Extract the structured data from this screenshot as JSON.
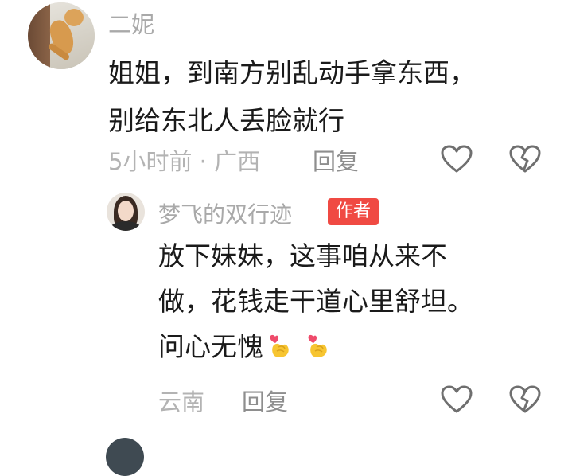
{
  "main_comment": {
    "username": "二妮",
    "text_lines": [
      "姐姐，到南方别乱动手拿东西，",
      "别给东北人丢脸就行"
    ],
    "meta": "5小时前 · 广西",
    "reply_label": "回复",
    "icons": {
      "avatar": "cat-photo-avatar",
      "like": "heart-outline-icon",
      "dislike": "broken-heart-icon"
    }
  },
  "reply_comment": {
    "username": "梦飞的双行迹",
    "badge": "作者",
    "text_lines": [
      "放下妹妹，这事咱从来不",
      "做，花钱走干道心里舒坦。",
      "问心无愧"
    ],
    "emoji": [
      "finger-heart-emoji",
      "finger-heart-emoji"
    ],
    "meta": "云南",
    "reply_label": "回复",
    "icons": {
      "avatar": "woman-portrait-avatar",
      "like": "heart-outline-icon",
      "dislike": "broken-heart-icon"
    }
  },
  "colors": {
    "username": "#a9a9a9",
    "text": "#1a1a1a",
    "meta": "#b3b3b3",
    "reply_action": "#8e8e8e",
    "badge_bg": "#f04a43",
    "icon_stroke": "#6f6f6f",
    "emoji_yellow": "#f7c531",
    "emoji_heart": "#ef4b6b"
  }
}
